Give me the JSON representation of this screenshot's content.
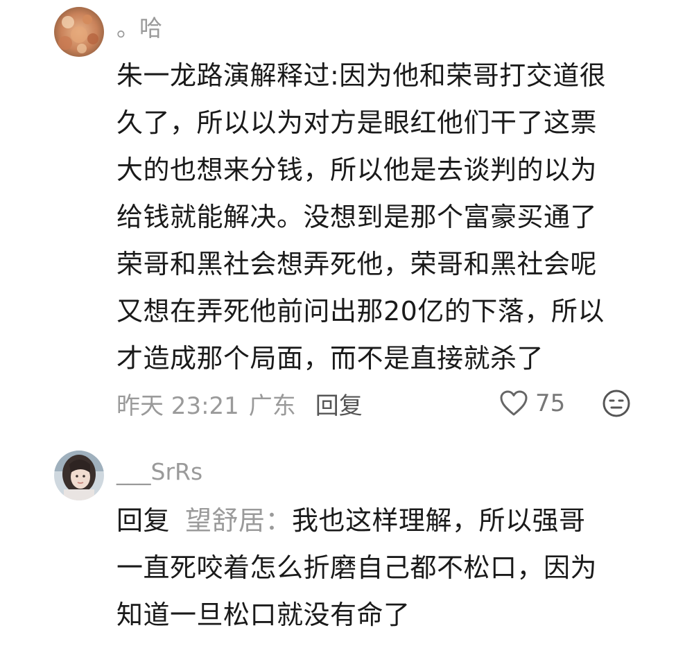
{
  "comments": [
    {
      "username": "。哈",
      "avatar_icon": "coral-photo-avatar",
      "lines": [
        "朱一龙路演解释过:因为他和荣哥打交道很",
        "久了，所以以为对方是眼红他们干了这票",
        "大的也想来分钱，所以他是去谈判的以为",
        "给钱就能解决。没想到是那个富豪买通了",
        "荣哥和黑社会想弄死他，荣哥和黑社会呢",
        "又想在弄死他前问出那20亿的下落，所以",
        "才造成那个局面，而不是直接就杀了"
      ],
      "time": "昨天 23:21",
      "location": "广东",
      "reply_label": "回复",
      "like_count": "75",
      "like_icon": "heart-outline-icon",
      "emoji_icon": "neutral-face-icon"
    },
    {
      "username": "___SrRs",
      "avatar_icon": "girl-photo-avatar",
      "reply_prefix": "回复",
      "reply_target": "望舒居",
      "reply_colon": "：",
      "first_line_text": "我也这样理解，所以强哥",
      "lines": [
        "一直死咬着怎么折磨自己都不松口，因为",
        "知道一旦松口就没有命了"
      ]
    }
  ],
  "colors": {
    "primary_text": "#1a1a1a",
    "secondary_text": "#9a9a9a",
    "background": "#ffffff"
  }
}
